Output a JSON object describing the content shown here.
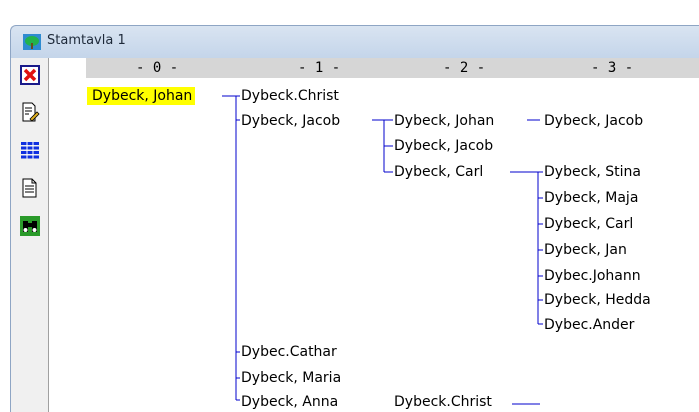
{
  "window": {
    "title": "Stamtavla 1"
  },
  "toolbar": {
    "items": [
      {
        "icon": "close-red-x-icon"
      },
      {
        "icon": "edit-document-icon"
      },
      {
        "icon": "blue-list-icon"
      },
      {
        "icon": "document-icon"
      },
      {
        "icon": "binoculars-search-icon"
      }
    ]
  },
  "generations": [
    "- 0 -",
    "- 1 -",
    "- 2 -",
    "- 3 -"
  ],
  "tree": {
    "root": "Dybeck, Johan",
    "gen1": [
      "Dybeck.Christ",
      "Dybeck, Jacob",
      "Dybec.Cathar",
      "Dybeck, Maria",
      "Dybeck, Anna"
    ],
    "gen2_jacob": [
      "Dybeck, Johan",
      "Dybeck, Jacob",
      "Dybeck, Carl"
    ],
    "gen2_anna": [
      "Dybeck.Christ"
    ],
    "gen3_johan": [
      "Dybeck, Jacob"
    ],
    "gen3_carl": [
      "Dybeck, Stina",
      "Dybeck, Maja",
      "Dybeck, Carl",
      "Dybeck, Jan",
      "Dybec.Johann",
      "Dybeck, Hedda",
      "Dybec.Ander"
    ]
  },
  "colors": {
    "selected": "#ffff00",
    "connector": "#0000cc",
    "header": "#d6d6d6"
  }
}
